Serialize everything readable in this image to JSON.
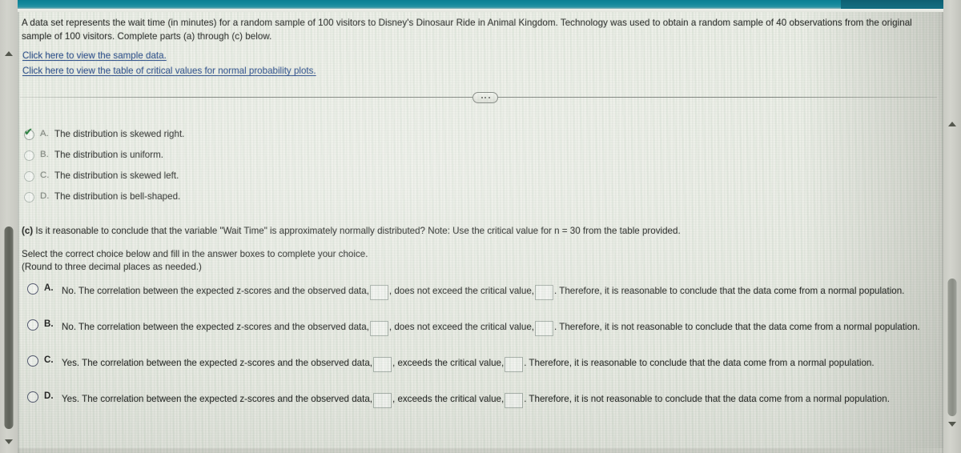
{
  "window": {
    "top_band_color": "#13899c",
    "page_background": "#eceee7"
  },
  "problem": {
    "statement": "A data set represents the wait time (in minutes) for a random sample of 100 visitors to Disney's Dinosaur Ride in Animal Kingdom. Technology was used to obtain a random sample of 40 observations from the original sample of 100 visitors. Complete parts (a) through (c) below.",
    "links": [
      {
        "label": "Click here to view the sample data.",
        "color": "#2b4f8e"
      },
      {
        "label": "Click here to view the table of critical values for normal probability plots.",
        "color": "#2b4f8e"
      }
    ],
    "more_button": {
      "name": "ellipsis",
      "glyph": "..."
    }
  },
  "part_b": {
    "options": [
      {
        "letter": "A.",
        "text": "The distribution is skewed right.",
        "selected": true,
        "check_mark": "✔",
        "check_color": "#1e7a34"
      },
      {
        "letter": "B.",
        "text": "The distribution is uniform.",
        "selected": false,
        "check_mark": "",
        "check_color": ""
      },
      {
        "letter": "C.",
        "text": "The distribution is skewed left.",
        "selected": false,
        "check_mark": "",
        "check_color": ""
      },
      {
        "letter": "D.",
        "text": "The distribution is bell-shaped.",
        "selected": false,
        "check_mark": "",
        "check_color": ""
      }
    ]
  },
  "part_c": {
    "label": "(c)",
    "question": "Is it reasonable to conclude that the variable \"Wait Time\" is approximately normally distributed? Note: Use the critical value for n = 30 from the table provided.",
    "instruction_line1": "Select the correct choice below and fill in the answer boxes to complete your choice.",
    "instruction_line2": "(Round to three decimal places as needed.)",
    "choices": [
      {
        "letter": "A.",
        "seg1": "No. The correlation between the expected z-scores and the observed data,",
        "box1": "",
        "seg2": ", does not exceed the critical value,",
        "box2": "",
        "seg3": ". Therefore, it is reasonable to conclude that the data come from a normal population.",
        "selected": false
      },
      {
        "letter": "B.",
        "seg1": "No. The correlation between the expected z-scores and the observed data,",
        "box1": "",
        "seg2": ", does not exceed the critical value,",
        "box2": "",
        "seg3": ". Therefore, it is not reasonable to conclude that the data come from a normal population.",
        "selected": false
      },
      {
        "letter": "C.",
        "seg1": "Yes. The correlation between the expected z-scores and the observed data,",
        "box1": "",
        "seg2": ", exceeds the critical value,",
        "box2": "",
        "seg3": ". Therefore, it is reasonable to conclude that the data come from a normal population.",
        "selected": false
      },
      {
        "letter": "D.",
        "seg1": "Yes. The correlation between the expected z-scores and the observed data,",
        "box1": "",
        "seg2": ", exceeds the critical value,",
        "box2": "",
        "seg3": ". Therefore, it is not reasonable to conclude that the data come from a normal population.",
        "selected": false
      }
    ]
  },
  "scrollbars": {
    "left": {
      "up_arrow": "▲",
      "down_arrow": "▼"
    },
    "right": {
      "up_arrow": "▲",
      "down_arrow": "▼"
    }
  }
}
